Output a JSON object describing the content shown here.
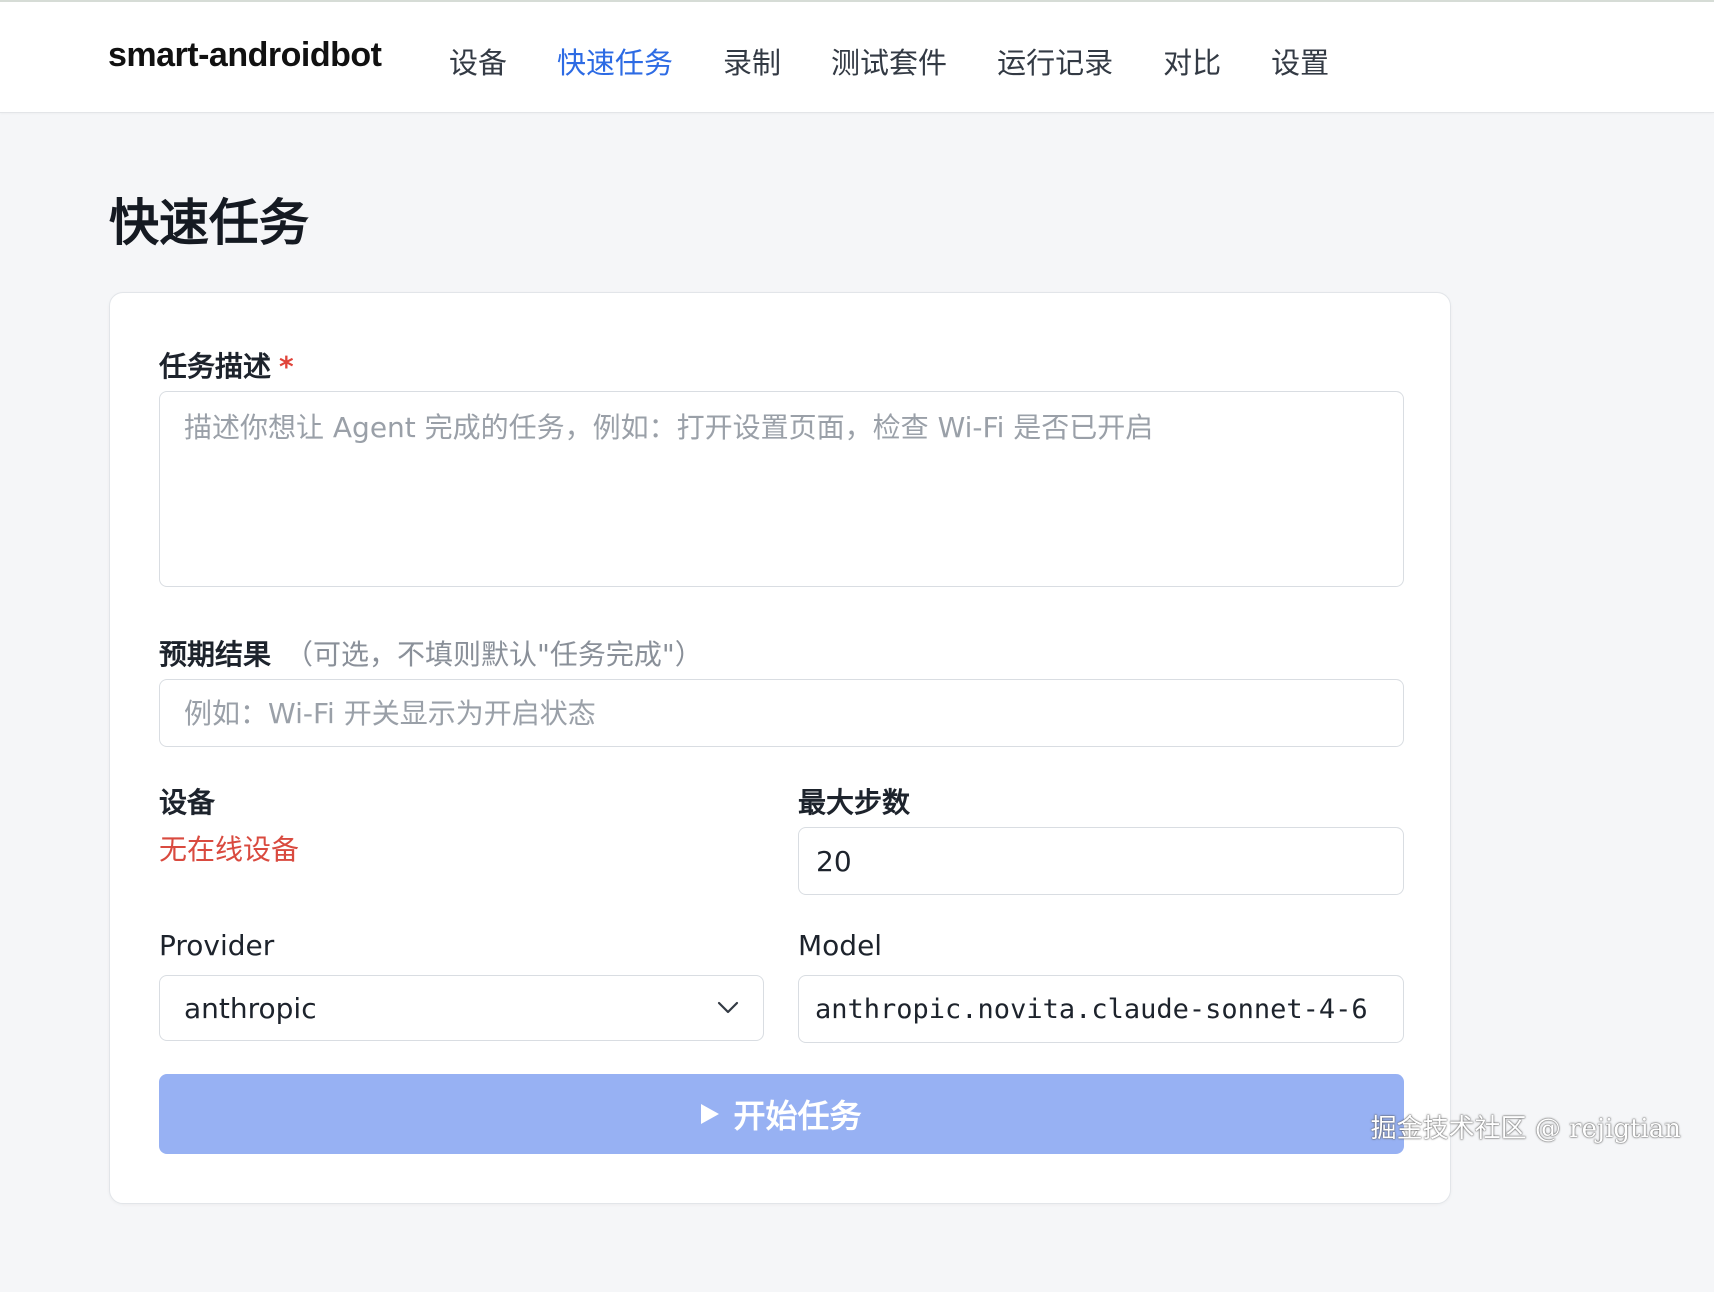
{
  "brand": "smart-androidbot",
  "nav": {
    "items": [
      {
        "label": "设备"
      },
      {
        "label": "快速任务"
      },
      {
        "label": "录制"
      },
      {
        "label": "测试套件"
      },
      {
        "label": "运行记录"
      },
      {
        "label": "对比"
      },
      {
        "label": "设置"
      }
    ],
    "active": "快速任务"
  },
  "page": {
    "title": "快速任务"
  },
  "form": {
    "task": {
      "label": "任务描述",
      "required_mark": "*",
      "placeholder": "描述你想让 Agent 完成的任务，例如：打开设置页面，检查 Wi-Fi 是否已开启",
      "value": ""
    },
    "expected": {
      "label": "预期结果",
      "hint": "（可选，不填则默认\"任务完成\"）",
      "placeholder": "例如：Wi-Fi 开关显示为开启状态",
      "value": ""
    },
    "device": {
      "label": "设备",
      "status": "无在线设备"
    },
    "max_steps": {
      "label": "最大步数",
      "value": "20"
    },
    "provider": {
      "label": "Provider",
      "value": "anthropic"
    },
    "model": {
      "label": "Model",
      "value": "anthropic.novita.claude-sonnet-4-6"
    },
    "submit": {
      "label": "开始任务"
    }
  },
  "colors": {
    "accent": "#2d6be4",
    "button": "#97b1f3",
    "error": "#d94a3f"
  },
  "icons": {
    "play": "play-icon",
    "chevron": "chevron-down-icon"
  },
  "watermark": "掘金技术社区 @ rejigtian"
}
